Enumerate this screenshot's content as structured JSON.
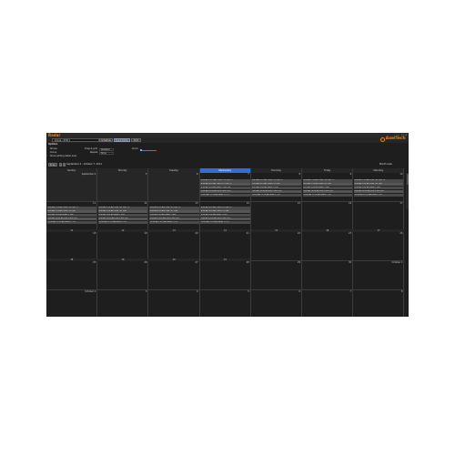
{
  "app": {
    "title": "Radar",
    "logo": "AxelTech",
    "colors": {
      "accent": "#f08a00",
      "today": "#2f6fd6"
    }
  },
  "toolbar": {
    "combo_value": "Group - SVN 1",
    "buttons": [
      "Schedule",
      "Event Editor",
      "Print"
    ],
    "active": 1
  },
  "options": {
    "title": "Options",
    "left": [
      "Shows",
      "Group",
      "Show editing detail area"
    ],
    "mid_labels": [
      "Drag & grid",
      "Repeat"
    ],
    "mid_values": [
      "Disabled",
      "None"
    ],
    "zoom_label": "Zoom"
  },
  "nav": {
    "today_label": "Today",
    "prev": "<",
    "next": ">",
    "range": "September 4 - October 7, 2011",
    "view": "Month view"
  },
  "days": [
    "Sunday",
    "Monday",
    "Tuesday",
    "Wednesday",
    "Thursday",
    "Friday",
    "Saturday"
  ],
  "weeks": [
    {
      "dates": [
        "September 4",
        "5",
        "6",
        "7",
        "8",
        "9",
        "10"
      ],
      "footer": [
        "",
        "",
        "",
        "",
        "",
        "",
        ""
      ]
    },
    {
      "dates": [
        "11",
        "12",
        "13",
        "14",
        "15",
        "16",
        "17"
      ],
      "footer": [
        "11",
        "12",
        "13",
        "14",
        "15",
        "16",
        "17"
      ]
    },
    {
      "dates": [
        "18",
        "19",
        "20",
        "21",
        "22",
        "23",
        "24"
      ],
      "footer": [
        "18",
        "19",
        "20",
        "21",
        "",
        "",
        ""
      ]
    },
    {
      "dates": [
        "25",
        "26",
        "27",
        "28",
        "29",
        "30",
        "October 1"
      ],
      "footer": [
        "",
        "",
        "",
        "",
        "",
        "",
        ""
      ]
    },
    {
      "dates": [
        "October 2",
        "3",
        "4",
        "5",
        "6",
        "7",
        "8"
      ],
      "footer": [
        "",
        "",
        "",
        "",
        "",
        "",
        ""
      ]
    }
  ],
  "events_week0": {
    "Wednesday": [
      "8:00 AM 10:15 AM Child TV3 (Q4) TV",
      "8:30 AM 9:15 AM Child TV1 (Q4) TV",
      "8:30 AM 9:00 AM Radio 1 (NS) Tue",
      "9:00 AM 10:30 AM SVN 2 Rec (Q2)",
      "10:30 AM 11:15 AM News 1 (TV)"
    ],
    "Thursday": [
      "8:00 AM 9:15 AM Child TV3 (Q4) TV",
      "8:30 AM 9:15 AM Child TV1 (Q4)",
      "8:30 AM 9:00 AM Radio 1 (NS)",
      "9:00 AM 10:30 AM SVN 2 Rec (Q2)",
      "10:30 AM 11:15 AM News 1 (TV)"
    ],
    "Friday": [
      "8:00 AM 9:15 AM Child TV3 (Q4) TV",
      "8:30 AM 9:15 AM Child TV1 (Q4)",
      "8:30 AM 9:00 AM Radio 1 (NS)",
      "9:00 AM 10:30 AM SVN 2 Rec (Q2)",
      "10:30 AM 11:15 AM News 1 (TV)"
    ],
    "Saturday": [
      "8:00 AM 9:15 AM Child TV3 (Q4) TV",
      "8:30 AM 9:15 AM Child TV1 (Q4)",
      "8:30 AM 9:00 AM Radio 1 (NS)",
      "9:00 AM 10:30 AM SVN 2 Rec (Q2)",
      "10:30 AM 11:15 AM News 1 (TV)"
    ]
  },
  "events_week1": {
    "Sunday": [
      "8:00 AM 9:15 AM Child TV3 (Q4) TV",
      "8:30 AM 9:15 AM Child TV1 (Q4)",
      "8:30 AM 9:00 AM Radio 1 (NS)",
      "9:00 AM 10:30 AM SVN 2 Rec (Q2)",
      "10:30 AM 11:15 AM News 1 (TV)"
    ],
    "Monday": [
      "8:00 AM 9:15 AM Child TV3 (Q4) TV",
      "8:30 AM 9:15 AM Child TV1 (Q4)",
      "8:30 AM 9:00 AM Radio 1 (NS)",
      "9:00 AM 10:30 AM SVN 2 Rec (Q2)",
      "10:30 AM 11:15 AM News 1 (TV)"
    ],
    "Tuesday": [
      "8:00 AM 9:15 AM Child TV3 (Q4) TV",
      "8:30 AM 9:15 AM Child TV1 (Q4)",
      "8:30 AM 9:00 AM Radio 1 (NS)",
      "9:00 AM 10:30 AM SVN 2 Rec (Q2)",
      "10:30 AM 11:15 AM News 1 (TV)"
    ],
    "Wednesday": [
      "8:00 AM 9:15 AM Child TV3 (Q4) TV",
      "8:30 AM 9:15 AM Child TV1 (Q4)",
      "8:30 AM 9:00 AM Radio 1 (NS)",
      "9:00 AM 10:30 AM SVN 2 Rec (Q2)",
      "10:30 AM 11:15 AM News 1 (TV)"
    ]
  }
}
